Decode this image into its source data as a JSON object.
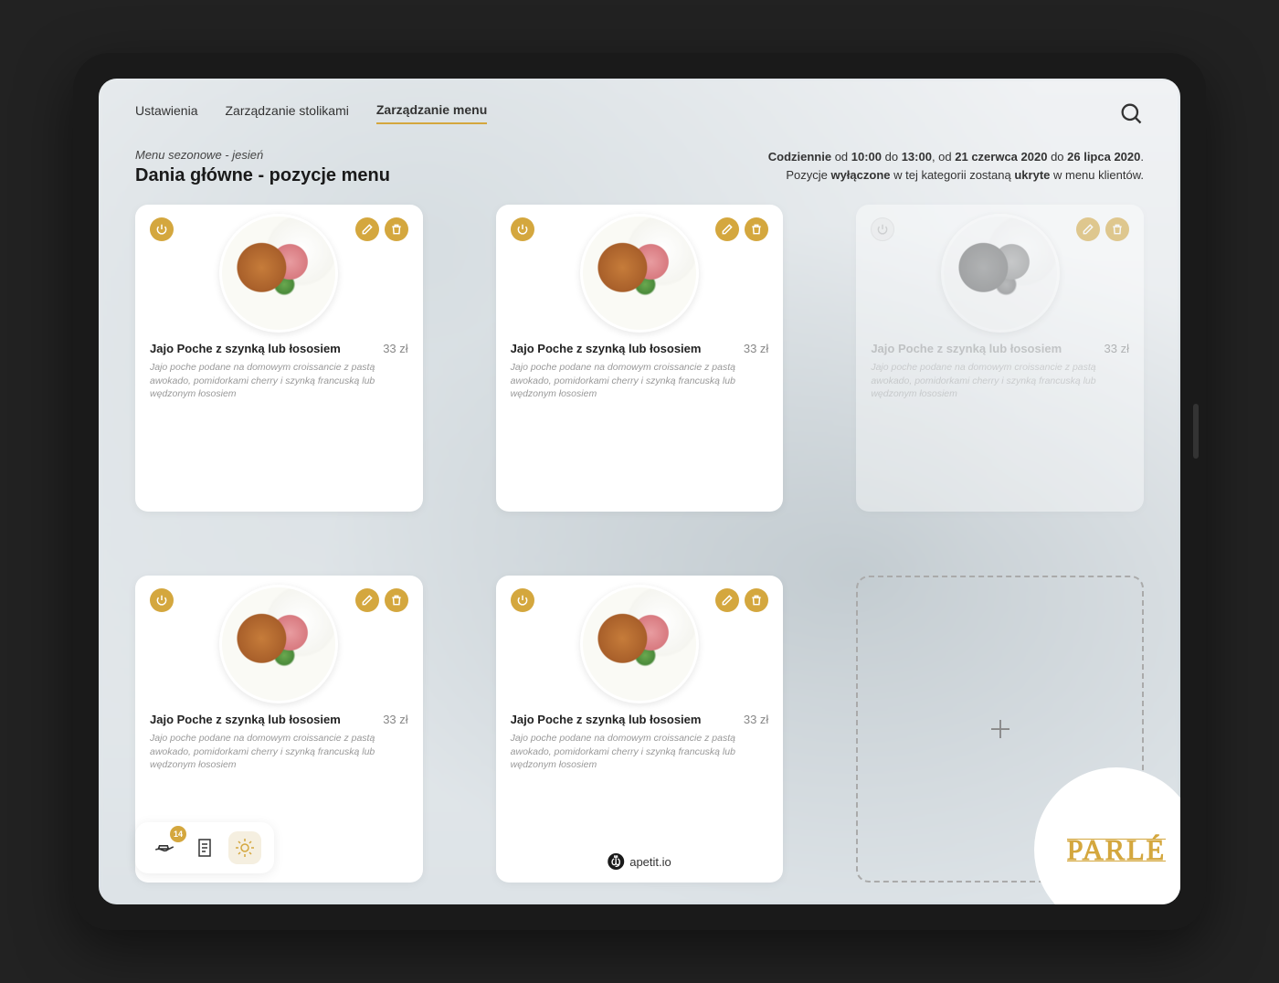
{
  "nav": {
    "items": [
      "Ustawienia",
      "Zarządzanie stolikami",
      "Zarządzanie menu"
    ],
    "active_index": 2
  },
  "header": {
    "breadcrumb": "Menu sezonowe - jesień",
    "title": "Dania główne - pozycje menu",
    "info_line1_prefix": "Codziennie",
    "info_line1_mid1": " od ",
    "info_time1": "10:00",
    "info_to": " do ",
    "info_time2": "13:00",
    "info_comma": ", od ",
    "info_date1": "21 czerwca 2020",
    "info_to2": " do ",
    "info_date2": "26 lipca 2020",
    "info_line2_a": "Pozycje ",
    "info_line2_b": "wyłączone",
    "info_line2_c": " w tej kategorii zostaną ",
    "info_line2_d": "ukryte",
    "info_line2_e": " w menu klientów."
  },
  "menu_items": [
    {
      "title": "Jajo Poche z szynką lub łososiem",
      "price": "33 zł",
      "desc": "Jajo poche podane na domowym croissancie z pastą awokado, pomidorkami cherry i szynką francuską lub wędzonym łososiem",
      "disabled": false
    },
    {
      "title": "Jajo Poche z szynką lub łososiem",
      "price": "33 zł",
      "desc": "Jajo poche podane na domowym croissancie z pastą awokado, pomidorkami cherry i szynką francuską lub wędzonym łososiem",
      "disabled": false
    },
    {
      "title": "Jajo Poche z szynką lub łososiem",
      "price": "33 zł",
      "desc": "Jajo poche podane na domowym croissancie z pastą awokado, pomidorkami cherry i szynką francuską lub wędzonym łososiem",
      "disabled": true
    },
    {
      "title": "Jajo Poche z szynką lub łososiem",
      "price": "33 zł",
      "desc": "Jajo poche podane na domowym croissancie z pastą awokado, pomidorkami cherry i szynką francuską lub wędzonym łososiem",
      "disabled": false
    },
    {
      "title": "Jajo Poche z szynką lub łososiem",
      "price": "33 zł",
      "desc": "Jajo poche podane na domowym croissancie z pastą awokado, pomidorkami cherry i szynką francuską lub wędzonym łososiem",
      "disabled": false
    }
  ],
  "bottom_bar": {
    "badge_count": "14"
  },
  "footer_brand": "apetit.io",
  "restaurant_logo": "PARLÉ",
  "colors": {
    "accent": "#d4a73e"
  }
}
